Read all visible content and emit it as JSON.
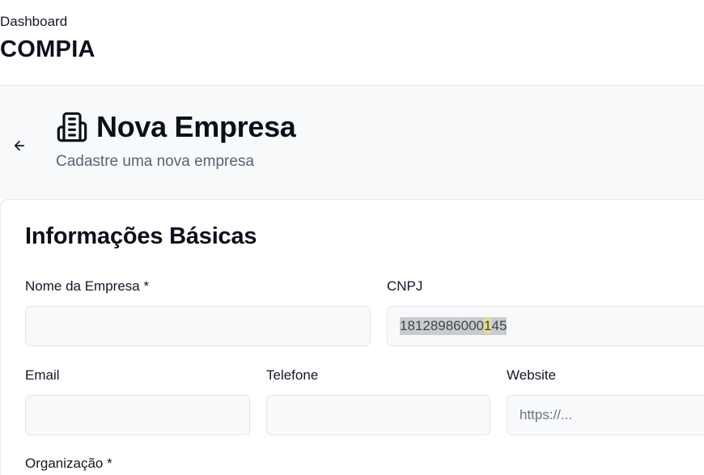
{
  "topbar": {
    "breadcrumb": "Dashboard",
    "brand": "COMPIA"
  },
  "header": {
    "back_icon": "arrow-left-icon",
    "title_icon": "building-icon",
    "title": "Nova Empresa",
    "subtitle": "Cadastre uma nova empresa"
  },
  "form": {
    "section_title": "Informações Básicas",
    "fields": {
      "company_name": {
        "label": "Nome da Empresa *",
        "value": ""
      },
      "cnpj": {
        "label": "CNPJ",
        "value_before": "18128986000",
        "value_cursor": "1",
        "value_after": "45"
      },
      "email": {
        "label": "Email",
        "value": ""
      },
      "phone": {
        "label": "Telefone",
        "value": ""
      },
      "website": {
        "label": "Website",
        "placeholder": "https://..."
      },
      "organization": {
        "label": "Organização *"
      }
    }
  },
  "colors": {
    "header_bg": "#f8f9fb",
    "input_bg": "#f8f9fb",
    "text_primary": "#0b0f19",
    "text_muted": "#5b6472"
  }
}
